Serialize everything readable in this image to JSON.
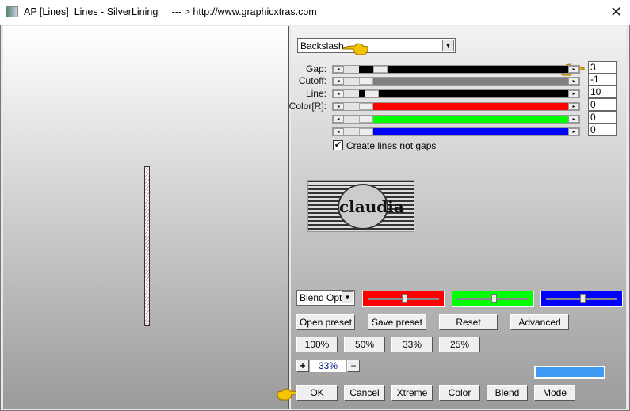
{
  "window": {
    "title": "AP [Lines]  Lines - SilverLining     --- > http://www.graphicxtras.com",
    "close": "✕"
  },
  "preset_dropdown": {
    "value": "Backslash"
  },
  "sliders": [
    {
      "label": "Gap:",
      "value": "3",
      "color": "#000000"
    },
    {
      "label": "Cutoff:",
      "value": "-1",
      "color": "#808080"
    },
    {
      "label": "Line:",
      "value": "10",
      "color": "#000000"
    },
    {
      "label": "Color[R]:",
      "value": "0",
      "color": "#ff0000"
    },
    {
      "label": "",
      "value": "0",
      "color": "#00ff00"
    },
    {
      "label": "",
      "value": "0",
      "color": "#0000ff"
    }
  ],
  "checkbox": {
    "label": "Create lines not gaps",
    "checked": true
  },
  "logo": {
    "text": "claudia"
  },
  "blend_dropdown": {
    "value": "Blend Optio"
  },
  "color_sliders": [
    {
      "color": "#ff0000",
      "level": 0.5
    },
    {
      "color": "#00ff00",
      "level": 0.5
    },
    {
      "color": "#0000ff",
      "level": 0.5
    }
  ],
  "preset_buttons": [
    "Open preset",
    "Save preset",
    "Reset",
    "Advanced"
  ],
  "zoom_buttons": [
    "100%",
    "50%",
    "33%",
    "25%"
  ],
  "zoom": {
    "plus": "+",
    "value": "33%",
    "minus": "−"
  },
  "swatch_color": "#3d9bf5",
  "action_buttons": [
    "OK",
    "Cancel",
    "Xtreme",
    "Color",
    "Blend",
    "Mode"
  ]
}
